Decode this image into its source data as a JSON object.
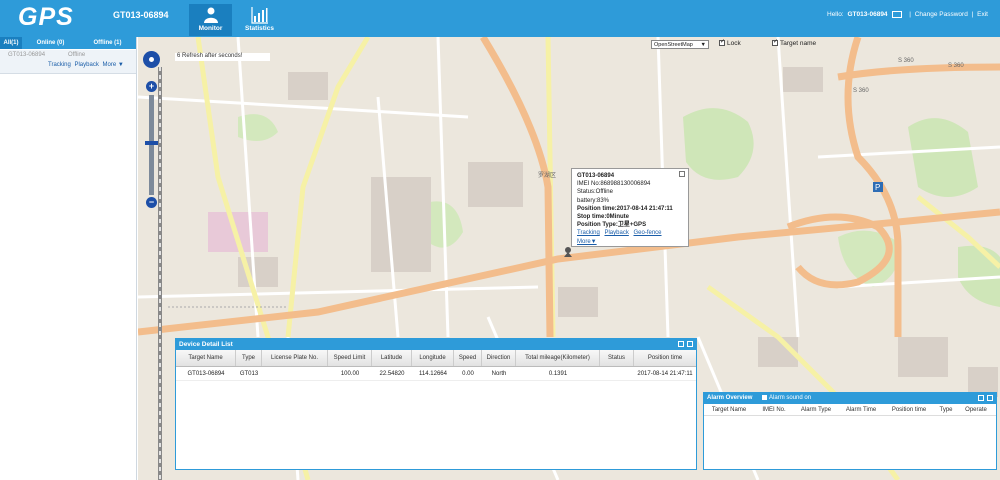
{
  "header": {
    "logo": "GPS",
    "unit_title": "GT013-06894",
    "nav": [
      {
        "label": "Monitor",
        "icon": "person-icon",
        "active": true
      },
      {
        "label": "Statistics",
        "icon": "bar-chart-icon",
        "active": false
      }
    ],
    "hello_label": "Hello:",
    "user": "GT013-06894",
    "change_password": "Change Password",
    "exit": "Exit"
  },
  "left_panel": {
    "tabs": [
      "All(1)",
      "Online (0)",
      "Offline (1)"
    ],
    "vehicles": [
      {
        "name": "GT013-06894",
        "status": "Offline",
        "actions": [
          "Tracking",
          "Playback",
          "More ▼"
        ]
      }
    ]
  },
  "map": {
    "refresh_text": "6 Refresh after seconds!",
    "map_type": "OpenStreetMap",
    "lock_label": "Lock",
    "target_name_label": "Target name",
    "labels": [
      "S 360",
      "S 360",
      "S 360",
      "罗湖区",
      "P"
    ],
    "info_window": {
      "title": "GT013-06894",
      "imei": "IMEI No:868988130006894",
      "status": "Status:Offline",
      "battery": "battery:83%",
      "position_time": "Position time:2017-08-14 21:47:11",
      "stop_time": "Stop time:0Minute",
      "position_type": "Position Type:卫星+GPS",
      "links": [
        "Tracking",
        "Playback",
        "Geo-fence",
        "More▼"
      ]
    }
  },
  "detail_list": {
    "title": "Device Detail List",
    "columns": [
      "Target Name",
      "Type",
      "License Plate No.",
      "Speed Limit",
      "Latitude",
      "Longitude",
      "Speed",
      "Direction",
      "Total mileage(Kilometer)",
      "Status",
      "Position time"
    ],
    "rows": [
      [
        "GT013-06894",
        "GT013",
        "",
        "100.00",
        "22.54820",
        "114.12664",
        "0.00",
        "North",
        "0.1391",
        "",
        "2017-08-14 21:47:11"
      ]
    ]
  },
  "alarm_overview": {
    "title": "Alarm Overview",
    "sound_label": "Alarm sound on",
    "columns": [
      "Target Name",
      "IMEI No.",
      "Alarm Type",
      "Alarm Time",
      "Position time",
      "Type",
      "Operate"
    ]
  }
}
